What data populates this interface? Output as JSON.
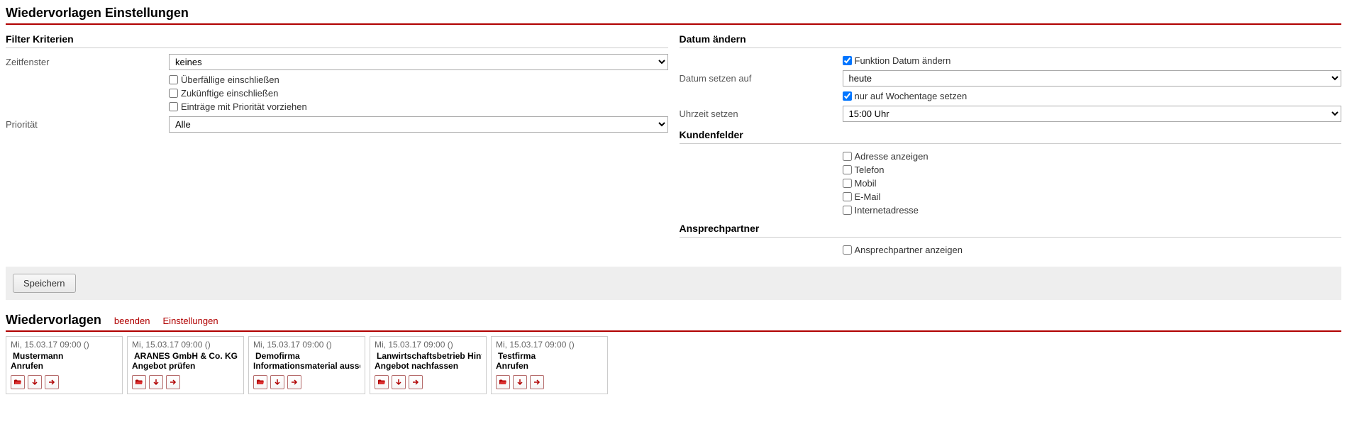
{
  "page_title": "Wiedervorlagen Einstellungen",
  "filter": {
    "heading": "Filter Kriterien",
    "zeitfenster_label": "Zeitfenster",
    "zeitfenster_value": "keines",
    "ueberfaellige_label": "Überfällige einschließen",
    "ueberfaellige_checked": false,
    "zukuenftige_label": "Zukünftige einschließen",
    "zukuenftige_checked": false,
    "prio_vorziehen_label": "Einträge mit Priorität vorziehen",
    "prio_vorziehen_checked": false,
    "prioritaet_label": "Priorität",
    "prioritaet_value": "Alle"
  },
  "datum": {
    "heading": "Datum ändern",
    "funktion_label": "Funktion Datum ändern",
    "funktion_checked": true,
    "setzen_auf_label": "Datum setzen auf",
    "setzen_auf_value": "heute",
    "wochentage_label": "nur auf Wochentage setzen",
    "wochentage_checked": true,
    "uhrzeit_label": "Uhrzeit setzen",
    "uhrzeit_value": "15:00 Uhr"
  },
  "kundenfelder": {
    "heading": "Kundenfelder",
    "adresse_label": "Adresse anzeigen",
    "adresse_checked": false,
    "telefon_label": "Telefon",
    "telefon_checked": false,
    "mobil_label": "Mobil",
    "mobil_checked": false,
    "email_label": "E-Mail",
    "email_checked": false,
    "internet_label": "Internetadresse",
    "internet_checked": false
  },
  "ansprechpartner": {
    "heading": "Ansprechpartner",
    "anzeigen_label": "Ansprechpartner anzeigen",
    "anzeigen_checked": false
  },
  "save_label": "Speichern",
  "wv": {
    "title": "Wiedervorlagen",
    "beenden_label": "beenden",
    "einstellungen_label": "Einstellungen",
    "cards": [
      {
        "date": "Mi, 15.03.17 09:00 ()",
        "company": "Mustermann",
        "task": "Anrufen"
      },
      {
        "date": "Mi, 15.03.17 09:00 ()",
        "company": "ARANES GmbH & Co. KG",
        "task": "Angebot prüfen"
      },
      {
        "date": "Mi, 15.03.17 09:00 ()",
        "company": "Demofirma",
        "task": "Informationsmaterial ausse"
      },
      {
        "date": "Mi, 15.03.17 09:00 ()",
        "company": "Lanwirtschaftsbetrieb Hinte",
        "task": "Angebot nachfassen"
      },
      {
        "date": "Mi, 15.03.17 09:00 ()",
        "company": "Testfirma",
        "task": "Anrufen"
      }
    ]
  },
  "icons": {
    "open": "open-icon",
    "down": "down-icon",
    "next": "next-icon"
  }
}
